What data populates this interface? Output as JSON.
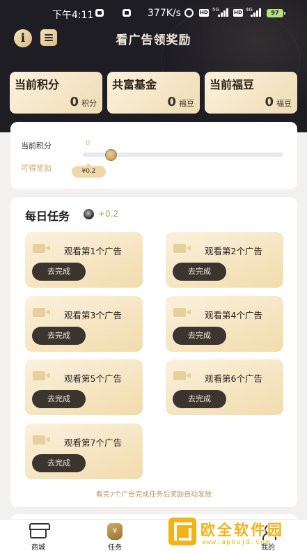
{
  "status_bar": {
    "time": "下午4:11",
    "speed": "377K/s",
    "hd": "HD",
    "net_5g": "5G",
    "net_4g": "4G",
    "battery": "97"
  },
  "header": {
    "title": "看广告领奖励",
    "info_icon": "info-icon",
    "menu_icon": "menu-icon"
  },
  "stats": [
    {
      "label": "当前积分",
      "value": "0",
      "unit": "积分"
    },
    {
      "label": "共富基金",
      "value": "0",
      "unit": "福豆"
    },
    {
      "label": "当前福豆",
      "value": "0",
      "unit": "福豆"
    }
  ],
  "progress": {
    "points_label": "当前积分",
    "reward_label": "可得奖励",
    "points_value": "0",
    "reward_value": "¥0.2",
    "level": 0.14
  },
  "tasks": {
    "title": "每日任务",
    "bonus": "+0.2",
    "button_label": "去完成",
    "items": [
      {
        "label": "观看第1个广告"
      },
      {
        "label": "观看第2个广告"
      },
      {
        "label": "观看第3个广告"
      },
      {
        "label": "观看第4个广告"
      },
      {
        "label": "观看第5个广告"
      },
      {
        "label": "观看第6个广告"
      },
      {
        "label": "观看第7个广告"
      }
    ],
    "note": "看完7个广告完成任务后奖励自动发放"
  },
  "bottom_nav": [
    {
      "label": "商城",
      "icon": "shop-icon"
    },
    {
      "label": "任务",
      "icon": "task-bag-icon"
    },
    {
      "label": "我的",
      "icon": "profile-icon"
    }
  ],
  "watermark": {
    "title": "欧全软件园",
    "url": "www.apoujd.com",
    "brand_color": "#f2b21a"
  },
  "colors": {
    "header_bg": "#1e1d24",
    "gold_card": "#f1dcad",
    "button_dark": "#3b342f",
    "accent_gold": "#b89a62"
  }
}
